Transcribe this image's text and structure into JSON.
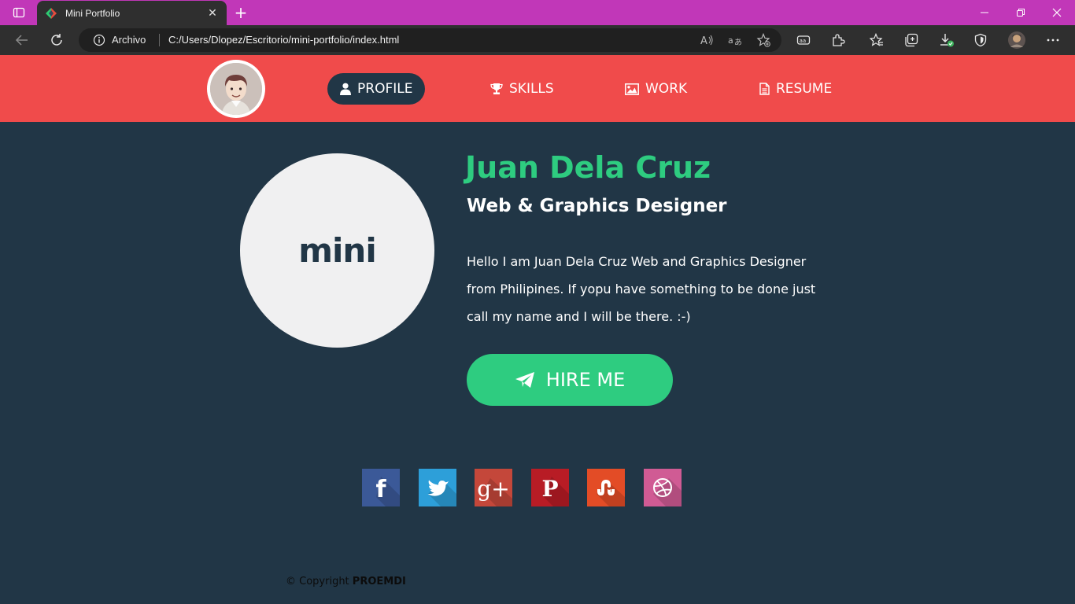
{
  "colors": {
    "tab_strip": "#c137b8",
    "toolbar": "#2f2f2f",
    "header": "#f04b4b",
    "page_bg": "#213646",
    "accent_green": "#2ecc80",
    "facebook": "#3b5998",
    "twitter": "#2d9fd9",
    "google_plus": "#c4473a",
    "pinterest": "#b81c25",
    "stumbleupon": "#e34c26",
    "dribbble": "#d05b94"
  },
  "browser": {
    "tab_title": "Mini Portfolio",
    "close_tab_glyph": "✕",
    "new_tab_glyph": "+",
    "omnibox": {
      "label": "Archivo",
      "url": "C:/Users/Dlopez/Escritorio/mini-portfolio/index.html"
    },
    "icons": [
      "tab-actions-icon",
      "back-icon",
      "refresh-icon",
      "info-icon",
      "read-aloud-icon",
      "translate-icon",
      "add-favorite-icon",
      "immersive-reader-icon",
      "extensions-icon",
      "favorites-icon",
      "collections-icon",
      "downloads-icon",
      "browser-essentials-icon",
      "profile-avatar-icon",
      "more-icon",
      "minimize-icon",
      "restore-icon",
      "close-window-icon"
    ]
  },
  "nav": {
    "items": [
      {
        "label": "PROFILE",
        "icon": "user-icon",
        "active": true
      },
      {
        "label": "SKILLS",
        "icon": "trophy-icon",
        "active": false
      },
      {
        "label": "WORK",
        "icon": "image-icon",
        "active": false
      },
      {
        "label": "RESUME",
        "icon": "document-icon",
        "active": false
      }
    ]
  },
  "profile": {
    "logo_text": "mini",
    "name": "Juan Dela Cruz",
    "role": "Web & Graphics Designer",
    "bio": "Hello I am Juan Dela Cruz Web and Graphics Designer from Philipines. If yopu have something to be done just call my name and I will be there. :-)",
    "hire_label": "HIRE ME"
  },
  "social": [
    {
      "name": "facebook",
      "glyph": "f"
    },
    {
      "name": "twitter",
      "glyph": ""
    },
    {
      "name": "google-plus",
      "glyph": "g+"
    },
    {
      "name": "pinterest",
      "glyph": "P"
    },
    {
      "name": "stumbleupon",
      "glyph": ""
    },
    {
      "name": "dribbble",
      "glyph": ""
    }
  ],
  "footer": {
    "copyright": "© Copyright",
    "brand": "PROEMDI"
  }
}
